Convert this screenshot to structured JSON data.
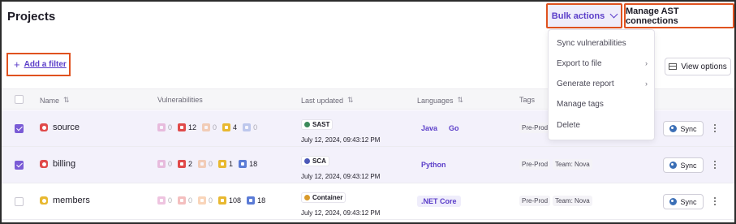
{
  "header": {
    "title": "Projects",
    "bulk_actions_label": "Bulk actions",
    "manage_ast_label": "Manage AST connections"
  },
  "toolbar": {
    "add_filter_label": "Add a filter",
    "view_options_label": "View options"
  },
  "bulk_menu": {
    "items": [
      {
        "label": "Sync vulnerabilities",
        "submenu": false
      },
      {
        "label": "Export to file",
        "submenu": true
      },
      {
        "label": "Generate report",
        "submenu": true
      },
      {
        "label": "Manage tags",
        "submenu": false
      },
      {
        "label": "Delete",
        "submenu": false
      }
    ]
  },
  "table": {
    "columns": [
      "Name",
      "Vulnerabilities",
      "Last updated",
      "Languages",
      "Tags"
    ],
    "rows": [
      {
        "selected": true,
        "name": "source",
        "name_color": "#e04a4a",
        "vulns": [
          "0",
          "12",
          "0",
          "4",
          "0"
        ],
        "scan": "SAST",
        "scan_color": "#3c8a5a",
        "date": "July 12, 2024,  09:43:12 PM",
        "languages": [
          "Java",
          "Go"
        ],
        "tags": [
          "Pre-Prod"
        ],
        "sync_label": "Sync"
      },
      {
        "selected": true,
        "name": "billing",
        "name_color": "#e04a4a",
        "vulns": [
          "0",
          "2",
          "0",
          "1",
          "18"
        ],
        "scan": "SCA",
        "scan_color": "#4b58b8",
        "date": "July 12, 2024,  09:43:12 PM",
        "languages": [
          "Python"
        ],
        "tags": [
          "Pre-Prod",
          "Team: Nova"
        ],
        "sync_label": "Sync"
      },
      {
        "selected": false,
        "name": "members",
        "name_color": "#e8b830",
        "vulns": [
          "0",
          "0",
          "0",
          "108",
          "18"
        ],
        "scan": "Container",
        "scan_color": "#d99a2b",
        "date": "July 12, 2024,  09:43:12 PM",
        "languages": [
          ".NET Core"
        ],
        "tags": [
          "Pre-Prod",
          "Team: Nova"
        ],
        "sync_label": "Sync"
      }
    ]
  },
  "severity_colors": [
    "#d15aa8",
    "#e04a4a",
    "#f08a3c",
    "#e8b830",
    "#5b7bd6"
  ],
  "icons": {
    "filter": "plus-icon",
    "view_options": "table-icon",
    "sync": "sync-icon",
    "row_menu": "kebab-icon",
    "dropdown": "chevron-down-icon"
  }
}
